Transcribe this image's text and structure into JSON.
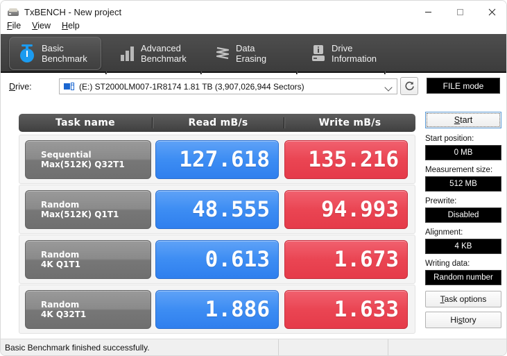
{
  "window": {
    "title": "TxBENCH - New project",
    "icon": "hard-drive-icon",
    "minimize": "—",
    "maximize": "□",
    "close": "✕"
  },
  "menubar": {
    "items": [
      {
        "label": "File",
        "mnemonic": "F"
      },
      {
        "label": "View",
        "mnemonic": "V"
      },
      {
        "label": "Help",
        "mnemonic": "H"
      }
    ]
  },
  "tabs": [
    {
      "label": "Basic\nBenchmark",
      "icon": "stopwatch-icon",
      "active": true
    },
    {
      "label": "Advanced\nBenchmark",
      "icon": "bar-chart-icon",
      "active": false
    },
    {
      "label": "Data Erasing",
      "icon": "zigzag-erase-icon",
      "active": false
    },
    {
      "label": "Drive\nInformation",
      "icon": "drive-info-icon",
      "active": false
    }
  ],
  "tab_overflow_icon": "chevron-down-icon",
  "drive": {
    "label": "Drive:",
    "label_mnemonic": "D",
    "selected": "(E:) ST2000LM007-1R8174  1.81 TB (3,907,026,944 Sectors)",
    "icon": "disk-drive-icon",
    "dropdown_icon": "chevron-down-icon",
    "refresh_icon": "refresh-icon",
    "mode_badge": "FILE mode"
  },
  "table": {
    "headers": [
      "Task name",
      "Read mB/s",
      "Write mB/s"
    ],
    "rows": [
      {
        "name_line1": "Sequential",
        "name_line2": "Max(512K) Q32T1",
        "read": "127.618",
        "write": "135.216"
      },
      {
        "name_line1": "Random",
        "name_line2": "Max(512K) Q1T1",
        "read": "48.555",
        "write": "94.993"
      },
      {
        "name_line1": "Random",
        "name_line2": "4K Q1T1",
        "read": "0.613",
        "write": "1.673"
      },
      {
        "name_line1": "Random",
        "name_line2": "4K Q32T1",
        "read": "1.886",
        "write": "1.633"
      }
    ]
  },
  "chart_data": {
    "type": "bar",
    "title": "TxBENCH Basic Benchmark results",
    "categories": [
      "Sequential Max(512K) Q32T1",
      "Random Max(512K) Q1T1",
      "Random 4K Q1T1",
      "Random 4K Q32T1"
    ],
    "series": [
      {
        "name": "Read mB/s",
        "values": [
          127.618,
          48.555,
          0.613,
          1.886
        ],
        "color": "#3d8df3"
      },
      {
        "name": "Write mB/s",
        "values": [
          135.216,
          94.993,
          1.673,
          1.633
        ],
        "color": "#ea4553"
      }
    ],
    "xlabel": "Task name",
    "ylabel": "mB/s",
    "legend": "top",
    "grid": false
  },
  "sidebar": {
    "start_button": "Start",
    "start_mnemonic": "S",
    "fields": [
      {
        "label": "Start position:",
        "value": "0 MB"
      },
      {
        "label": "Measurement size:",
        "value": "512 MB"
      },
      {
        "label": "Prewrite:",
        "value": "Disabled"
      },
      {
        "label": "Alignment:",
        "value": "4 KB"
      },
      {
        "label": "Writing data:",
        "value": "Random number"
      }
    ],
    "buttons": [
      {
        "label": "Task options",
        "mnemonic": "T"
      },
      {
        "label": "History",
        "mnemonic": "s"
      }
    ]
  },
  "statusbar": {
    "message": "Basic Benchmark finished successfully.",
    "cell2": "",
    "cell3": ""
  },
  "colors": {
    "read_bar": "#3d8df3",
    "write_bar": "#ea4553",
    "accent_blue": "#1b9bf0",
    "toolbar_dark": "#464646",
    "field_bg": "#000000"
  }
}
